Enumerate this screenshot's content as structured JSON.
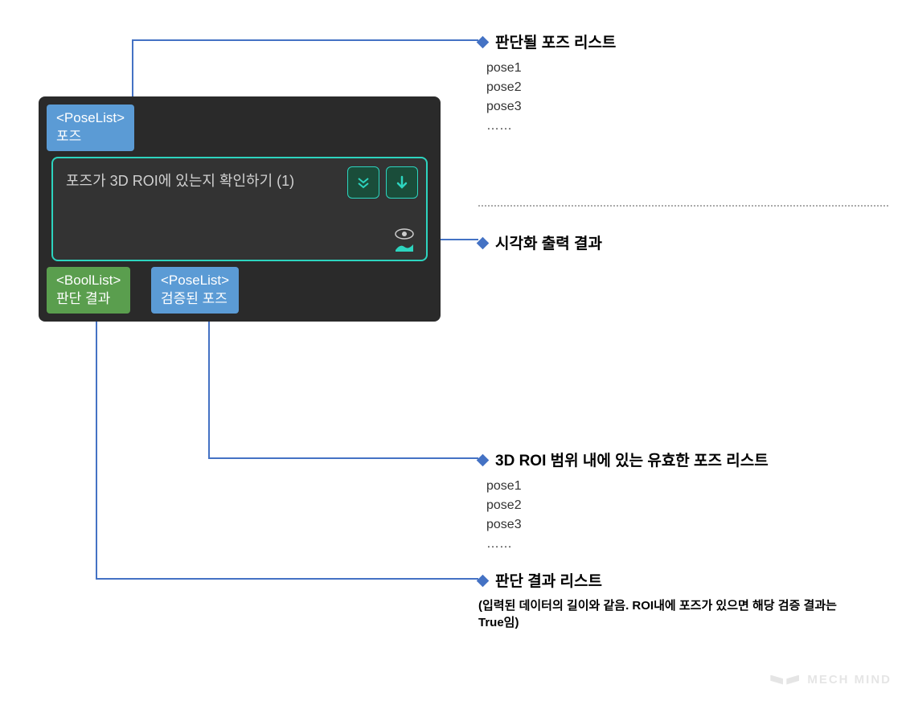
{
  "node": {
    "input_port": {
      "type": "<PoseList>",
      "label": "포즈"
    },
    "title": "포즈가 3D ROI에 있는지 확인하기 (1)",
    "output_port_1": {
      "type": "<BoolList>",
      "label": "판단 결과"
    },
    "output_port_2": {
      "type": "<PoseList>",
      "label": "검증된 포즈"
    }
  },
  "annotations": {
    "input": {
      "title": "판단될 포즈 리스트",
      "items": [
        "pose1",
        "pose2",
        "pose3",
        "……"
      ]
    },
    "visualize": {
      "title": "시각화 출력 결과"
    },
    "valid_poses": {
      "title": "3D ROI 범위 내에 있는 유효한 포즈 리스트",
      "items": [
        "pose1",
        "pose2",
        "pose3",
        "……"
      ]
    },
    "result": {
      "title": "판단 결과 리스트",
      "subtitle": "(입력된 데이터의 길이와 같음. ROI내에 포즈가 있으면 해당 검증 결과는 True임)"
    }
  },
  "watermark": "MECH MIND"
}
